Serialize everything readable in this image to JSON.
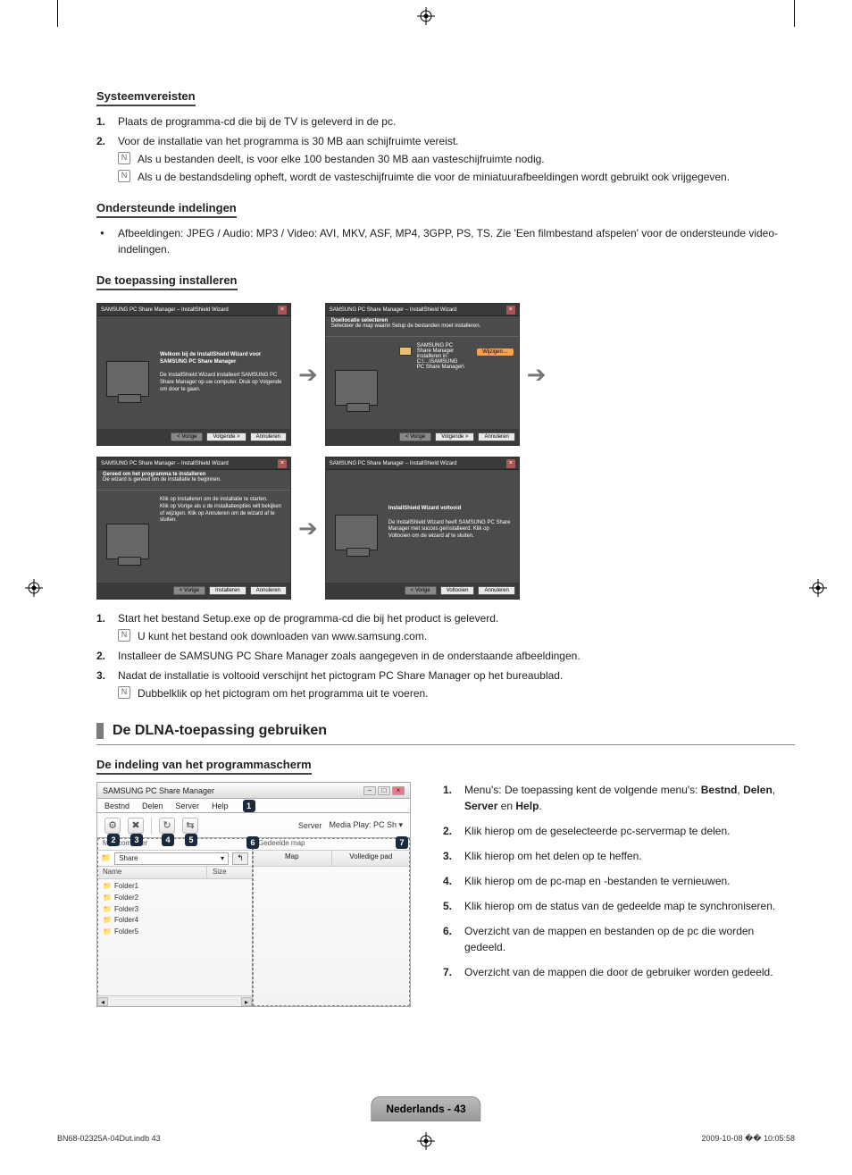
{
  "headings": {
    "sysreq": "Systeemvereisten",
    "formats": "Ondersteunde indelingen",
    "install": "De toepassing installeren",
    "dlna": "De DLNA-toepassing gebruiken",
    "layout": "De indeling van het programmascherm"
  },
  "sysreq_list": {
    "i1": "Plaats de programma-cd die bij de TV is geleverd in de pc.",
    "i2": "Voor de installatie van het programma is 30 MB aan schijfruimte vereist.",
    "note1": "Als u bestanden deelt, is voor elke 100 bestanden 30 MB aan vasteschijfruimte nodig.",
    "note2": "Als u de bestandsdeling opheft, wordt de vasteschijfruimte die voor de miniatuurafbeeldingen wordt gebruikt ook vrijgegeven."
  },
  "formats_list": {
    "i1": "Afbeeldingen: JPEG / Audio: MP3 / Video: AVI, MKV, ASF, MP4, 3GPP, PS, TS. Zie 'Een filmbestand afspelen' voor de ondersteunde video-indelingen."
  },
  "wizard": {
    "title": "SAMSUNG PC Share Manager – InstallShield Wizard",
    "w1_h": "Welkom bij de InstallShield Wizard voor SAMSUNG PC Share Manager",
    "w1_b": "De InstallShield Wizard installeert SAMSUNG PC Share Manager op uw computer. Druk op Volgende om door te gaan.",
    "w2_sub1": "Doellocatie selecteren",
    "w2_sub2": "Selecteer de map waarin Setup de bestanden moet installeren.",
    "w2_line": "SAMSUNG PC Share Manager installeren in:\nC:\\…\\SAMSUNG PC Share Manager\\",
    "w2_btn": "Wijzigen…",
    "w3_sub1": "Gereed om het programma te installeren",
    "w3_sub2": "De wizard is gereed om de installatie te beginnen.",
    "w3_b": "Klik op Installeren om de installatie te starten.\nKlik op Vorige als u de installatieopties wilt bekijken of wijzigen. Klik op Annuleren om de wizard af te sluiten.",
    "w4_h": "InstallShield Wizard voltooid",
    "w4_b": "De InstallShield Wizard heeft SAMSUNG PC Share Manager met succes geïnstalleerd. Klik op Voltooien om de wizard af te sluiten.",
    "btn_back": "< Vorige",
    "btn_next": "Volgende >",
    "btn_install": "Installeren",
    "btn_finish": "Voltooien",
    "btn_cancel": "Annuleren"
  },
  "install_list": {
    "i1": "Start het bestand Setup.exe op de programma-cd die bij het product is geleverd.",
    "note1": "U kunt het bestand ook downloaden van www.samsung.com.",
    "i2": "Installeer de SAMSUNG PC Share Manager zoals aangegeven in de onderstaande afbeeldingen.",
    "i3": "Nadat de installatie is voltooid verschijnt het pictogram PC Share Manager op het bureaublad.",
    "note3": "Dubbelklik op het pictogram om het programma uit te voeren."
  },
  "app": {
    "title": "SAMSUNG PC Share Manager",
    "menus": {
      "m1": "Bestnd",
      "m2": "Delen",
      "m3": "Server",
      "m4": "Help"
    },
    "toolbar_right_label": "Server",
    "toolbar_right_value": "Media Play: PC Sh ▾",
    "left_head": "Mijn computer",
    "share_select": "Share",
    "grid_c1": "Name",
    "grid_c2": "Size",
    "folders": [
      "Folder1",
      "Folder2",
      "Folder3",
      "Folder4",
      "Folder5"
    ],
    "right_head": "Gedeelde map",
    "right_c1": "Map",
    "right_c2": "Volledige pad"
  },
  "layout_list": {
    "i1_pre": "Menu's: De toepassing kent de volgende menu's: ",
    "i1_b1": "Bestnd",
    "i1_s1": ", ",
    "i1_b2": "Delen",
    "i1_s2": ", ",
    "i1_b3": "Server",
    "i1_s3": " en ",
    "i1_b4": "Help",
    "i1_end": ".",
    "i2": "Klik hierop om de geselecteerde pc-servermap te delen.",
    "i3": "Klik hierop om het delen op te heffen.",
    "i4": "Klik hierop om de pc-map en -bestanden te vernieuwen.",
    "i5": "Klik hierop om de status van de gedeelde map te synchroniseren.",
    "i6": "Overzicht van de mappen en bestanden op de pc die worden gedeeld.",
    "i7": "Overzicht van de mappen die door de gebruiker worden gedeeld."
  },
  "footer": {
    "pill": "Nederlands - 43",
    "left": "BN68-02325A-04Dut.indb   43",
    "right": "2009-10-08   �� 10:05:58"
  },
  "note_glyph": "N"
}
